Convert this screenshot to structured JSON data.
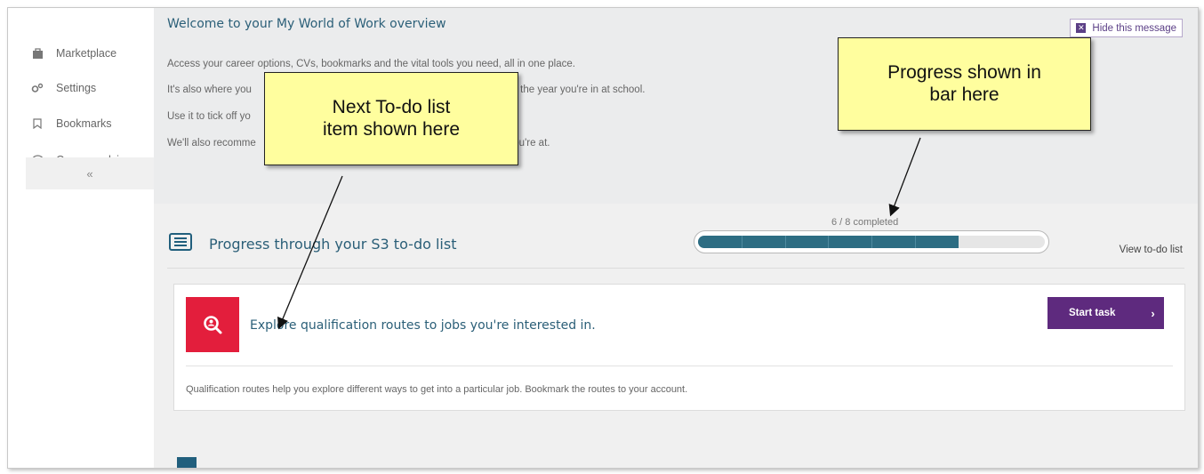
{
  "sidebar": {
    "items": [
      {
        "label": "Marketplace",
        "icon": "bag-icon"
      },
      {
        "label": "Settings",
        "icon": "gears-icon"
      },
      {
        "label": "Bookmarks",
        "icon": "bookmark-icon"
      },
      {
        "label": "Careers adviser",
        "icon": "chat-icon"
      }
    ],
    "collapse_label": "«"
  },
  "welcome": {
    "title": "Welcome to your My World of Work overview",
    "hide_label": "Hide this message",
    "lines": [
      "Access your career options, CVs, bookmarks and the vital tools you need, all in one place.",
      "It's also where you                                                         designed especially for the year you're in at school.",
      "Use it to tick off yo                                                        g up.",
      "We'll also recomme                                                          you are and where you're at."
    ]
  },
  "progress": {
    "title": "Progress through your S3 to-do list",
    "completed_text": "6 / 8 completed",
    "completed": 6,
    "total": 8,
    "view_link": "View to-do list"
  },
  "task": {
    "title": "Explore qualification routes to jobs you're interested in.",
    "button_label": "Start task",
    "description": "Qualification routes help you explore different ways to get into a particular job. Bookmark the routes to your account."
  },
  "annotations": {
    "todo_callout": [
      "Next To-do list",
      "item shown here"
    ],
    "progress_callout": [
      "Progress shown in",
      "bar here"
    ]
  },
  "colors": {
    "accent_teal": "#2b5f78",
    "progress_fill": "#2d6d83",
    "task_icon_red": "#e31e3c",
    "button_purple": "#5e2a7e",
    "callout_yellow": "#fffe9e"
  }
}
